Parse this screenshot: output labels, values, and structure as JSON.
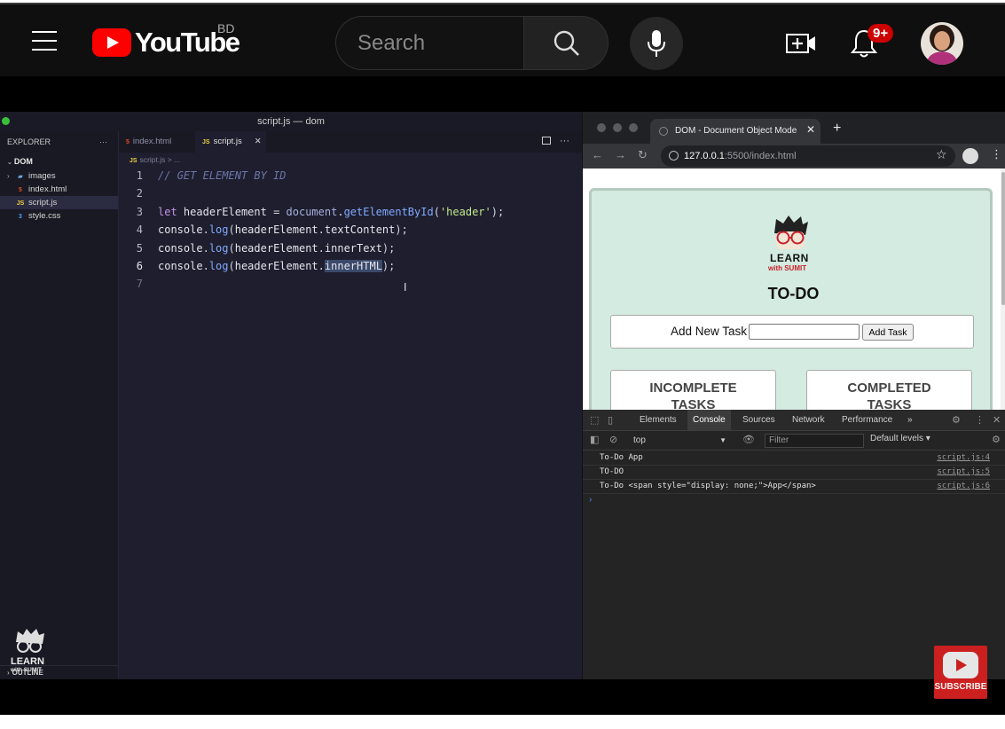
{
  "youtube": {
    "logo_text": "YouTube",
    "region": "BD",
    "search": {
      "placeholder": "Search"
    },
    "notifications_badge": "9+",
    "icons": [
      "menu-icon",
      "search-icon",
      "mic-icon",
      "create-video-icon",
      "bell-icon"
    ],
    "brand_color": "#ff0000"
  },
  "vscode": {
    "window_title": "script.js — dom",
    "explorer_label": "EXPLORER",
    "explorer_more": "···",
    "project": "DOM",
    "files": [
      {
        "name": "images",
        "icon": "folder-icon"
      },
      {
        "name": "index.html",
        "icon": "html-file-icon"
      },
      {
        "name": "script.js",
        "icon": "js-file-icon"
      },
      {
        "name": "style.css",
        "icon": "css-file-icon"
      }
    ],
    "tabs": [
      {
        "label": "index.html"
      },
      {
        "label": "script.js",
        "close": "✕"
      }
    ],
    "breadcrumb": "script.js > ...",
    "line_numbers": [
      "1",
      "2",
      "3",
      "4",
      "5",
      "6",
      "7"
    ],
    "code_tokens": {
      "l1_comment": "// GET ELEMENT BY ID",
      "let": "let",
      "var": "headerElement",
      "eq": " = ",
      "document": "document",
      "getById": "getElementById",
      "str_header": "'header'",
      "console": "console",
      "log": "log",
      "textContent": "textContent",
      "innerText": "innerText",
      "innerHTML": "innerHTML"
    },
    "outline_label": "OUTLINE",
    "logo_text": [
      "LEARN",
      "with SUMIT"
    ]
  },
  "browser": {
    "tab_title": "DOM - Document Object Mode",
    "tab_close": "✕",
    "new_tab": "+",
    "url_host": "127.0.0.1",
    "url_rest": ":5500/index.html",
    "page": {
      "logo_text": [
        "LEARN",
        "with SUMIT"
      ],
      "title": "TO-DO",
      "add_label": "Add New Task",
      "add_button": "Add Task",
      "incomplete": [
        "INCOMPLETE",
        "TASKS"
      ],
      "completed": [
        "COMPLETED",
        "TASKS"
      ]
    },
    "devtools": {
      "tabs": [
        "Elements",
        "Console",
        "Sources",
        "Network",
        "Performance"
      ],
      "more": "»",
      "context": "top",
      "filter_placeholder": "Filter",
      "levels": "Default levels ▾",
      "logs": [
        {
          "msg": "To-Do App",
          "src": "script.js:4"
        },
        {
          "msg": "TO-DO",
          "src": "script.js:5"
        },
        {
          "msg": "To-Do <span style=\"display: none;\">App</span>",
          "src": "script.js:6"
        }
      ],
      "prompt": "›"
    }
  },
  "subscribe": {
    "label": "SUBSCRIBE"
  }
}
